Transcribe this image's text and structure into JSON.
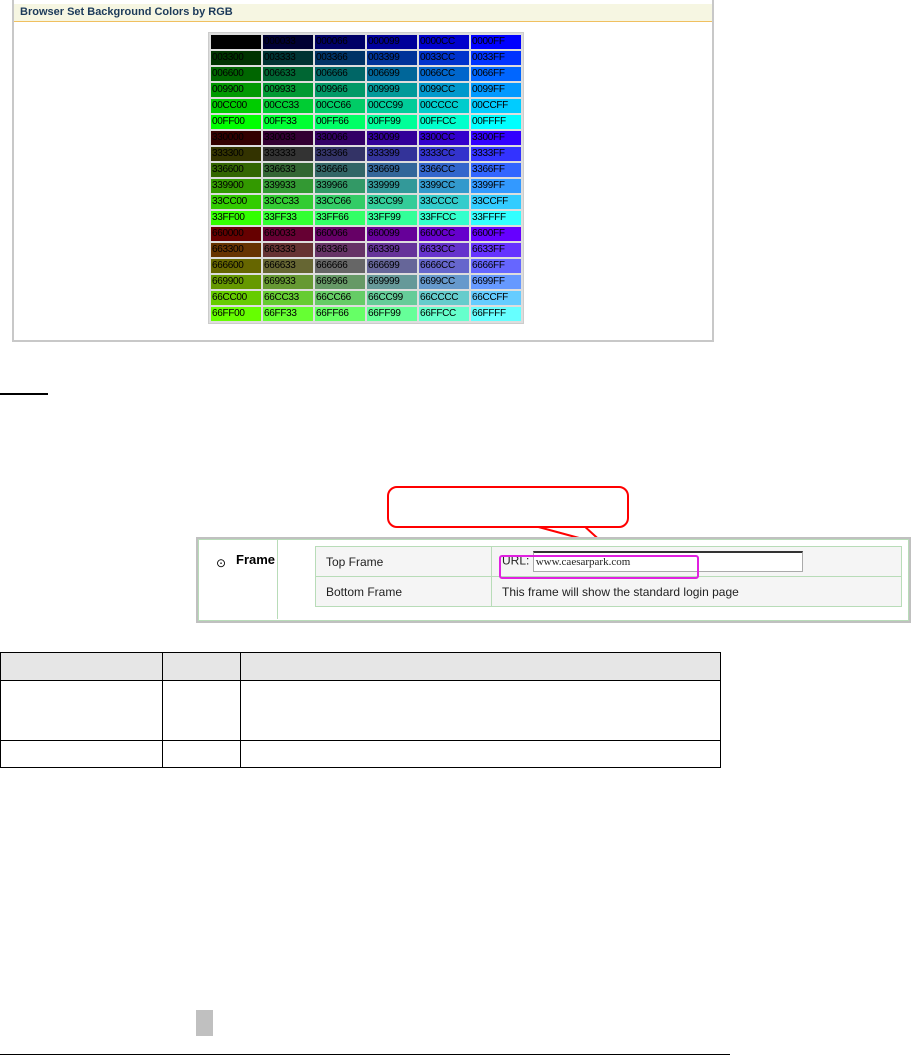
{
  "panel": {
    "title": "Browser Set Background Colors by RGB"
  },
  "color_table": [
    [
      "000000",
      "000033",
      "000066",
      "000099",
      "0000CC",
      "0000FF"
    ],
    [
      "003300",
      "003333",
      "003366",
      "003399",
      "0033CC",
      "0033FF"
    ],
    [
      "006600",
      "006633",
      "006666",
      "006699",
      "0066CC",
      "0066FF"
    ],
    [
      "009900",
      "009933",
      "009966",
      "009999",
      "0099CC",
      "0099FF"
    ],
    [
      "00CC00",
      "00CC33",
      "00CC66",
      "00CC99",
      "00CCCC",
      "00CCFF"
    ],
    [
      "00FF00",
      "00FF33",
      "00FF66",
      "00FF99",
      "00FFCC",
      "00FFFF"
    ],
    [
      "330000",
      "330033",
      "330066",
      "330099",
      "3300CC",
      "3300FF"
    ],
    [
      "333300",
      "333333",
      "333366",
      "333399",
      "3333CC",
      "3333FF"
    ],
    [
      "336600",
      "336633",
      "336666",
      "336699",
      "3366CC",
      "3366FF"
    ],
    [
      "339900",
      "339933",
      "339966",
      "339999",
      "3399CC",
      "3399FF"
    ],
    [
      "33CC00",
      "33CC33",
      "33CC66",
      "33CC99",
      "33CCCC",
      "33CCFF"
    ],
    [
      "33FF00",
      "33FF33",
      "33FF66",
      "33FF99",
      "33FFCC",
      "33FFFF"
    ],
    [
      "660000",
      "660033",
      "660066",
      "660099",
      "6600CC",
      "6600FF"
    ],
    [
      "663300",
      "663333",
      "663366",
      "663399",
      "6633CC",
      "6633FF"
    ],
    [
      "666600",
      "666633",
      "666666",
      "666699",
      "6666CC",
      "6666FF"
    ],
    [
      "669900",
      "669933",
      "669966",
      "669999",
      "6699CC",
      "6699FF"
    ],
    [
      "66CC00",
      "66CC33",
      "66CC66",
      "66CC99",
      "66CCCC",
      "66CCFF"
    ],
    [
      "66FF00",
      "66FF33",
      "66FF66",
      "66FF99",
      "66FFCC",
      "66FFFF"
    ]
  ],
  "frame": {
    "label": "Frame",
    "top_label": "Top Frame",
    "url_label": "URL:",
    "url_value": "www.caesarpark.com",
    "bottom_label": "Bottom Frame",
    "bottom_desc": "This frame will show the standard login page"
  },
  "colors": {
    "callout": "#ff0000",
    "highlight": "#e020e0",
    "grid": "#b8dcb8"
  }
}
